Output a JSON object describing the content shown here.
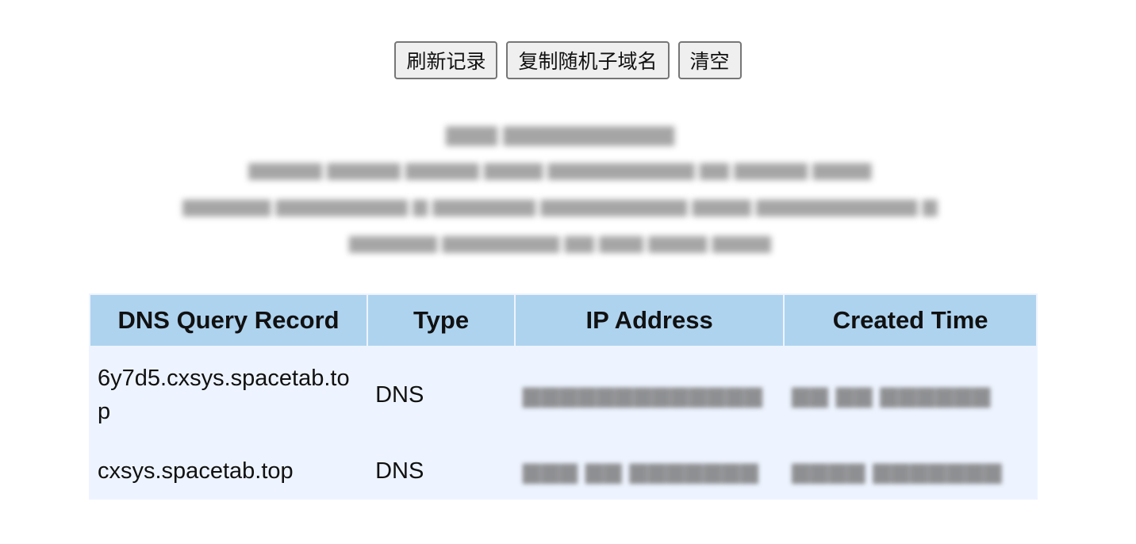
{
  "toolbar": {
    "refresh_label": "刷新记录",
    "copy_label": "复制随机子域名",
    "clear_label": "清空"
  },
  "table": {
    "headers": [
      "DNS Query Record",
      "Type",
      "IP Address",
      "Created Time"
    ],
    "rows": [
      {
        "record": "6y7d5.cxsys.spacetab.top",
        "type": "DNS"
      },
      {
        "record": "cxsys.spacetab.top",
        "type": "DNS"
      }
    ]
  },
  "colors": {
    "header_bg": "#aed3ef",
    "body_bg": "#eef4ff",
    "button_bg": "#efefef"
  }
}
